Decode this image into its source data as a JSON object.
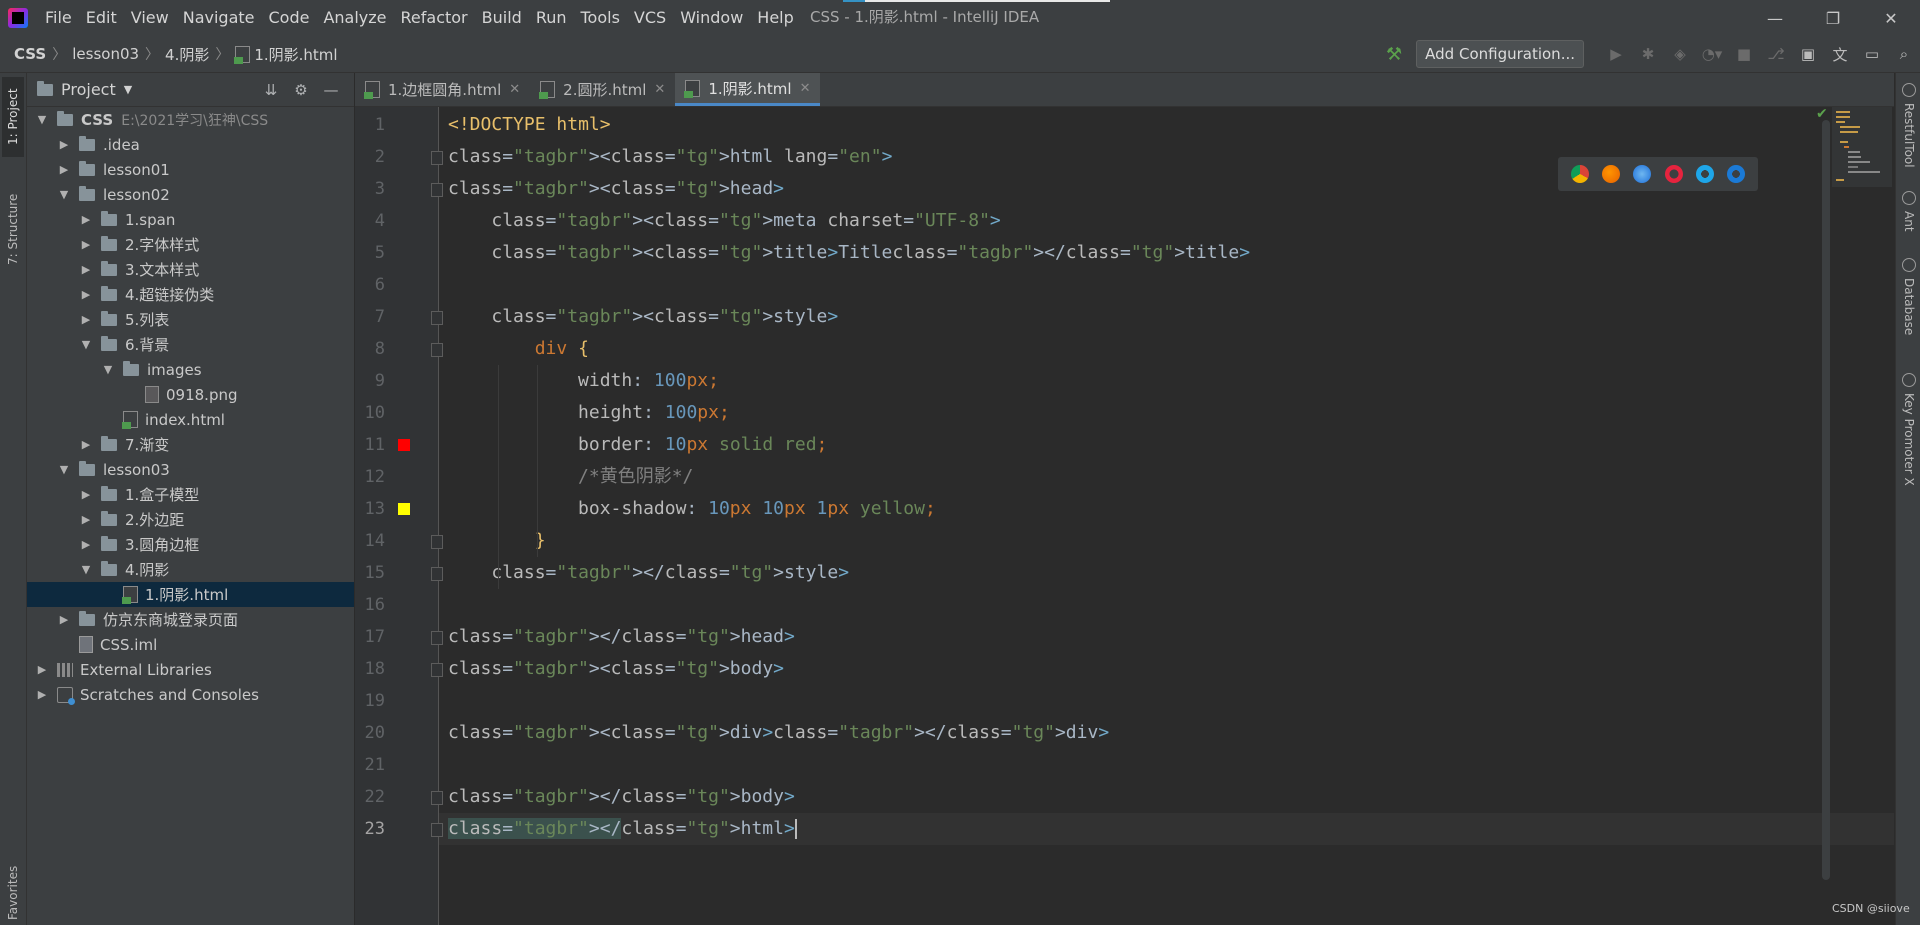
{
  "window": {
    "title": "CSS - 1.阴影.html - IntelliJ IDEA",
    "controls": {
      "minimize": "—",
      "restore": "❐",
      "close": "✕"
    }
  },
  "menu": [
    "File",
    "Edit",
    "View",
    "Navigate",
    "Code",
    "Analyze",
    "Refactor",
    "Build",
    "Run",
    "Tools",
    "VCS",
    "Window",
    "Help"
  ],
  "breadcrumb": [
    "CSS",
    "lesson03",
    "4.阴影",
    "1.阴影.html"
  ],
  "toolbar": {
    "add_config": "Add Configuration..."
  },
  "left_stripe": {
    "project": "1: Project",
    "structure": "7: Structure",
    "favorites": "Favorites"
  },
  "project_panel": {
    "title": "Project",
    "tree": [
      {
        "label": "CSS",
        "path": "E:\\2021学习\\狂神\\CSS",
        "depth": 0,
        "arrow": "▼",
        "type": "folder",
        "bold": true
      },
      {
        "label": ".idea",
        "depth": 1,
        "arrow": "▶",
        "type": "folder"
      },
      {
        "label": "lesson01",
        "depth": 1,
        "arrow": "▶",
        "type": "folder"
      },
      {
        "label": "lesson02",
        "depth": 1,
        "arrow": "▼",
        "type": "folder"
      },
      {
        "label": "1.span",
        "depth": 2,
        "arrow": "▶",
        "type": "folder"
      },
      {
        "label": "2.字体样式",
        "depth": 2,
        "arrow": "▶",
        "type": "folder"
      },
      {
        "label": "3.文本样式",
        "depth": 2,
        "arrow": "▶",
        "type": "folder"
      },
      {
        "label": "4.超链接伪类",
        "depth": 2,
        "arrow": "▶",
        "type": "folder"
      },
      {
        "label": "5.列表",
        "depth": 2,
        "arrow": "▶",
        "type": "folder"
      },
      {
        "label": "6.背景",
        "depth": 2,
        "arrow": "▼",
        "type": "folder"
      },
      {
        "label": "images",
        "depth": 3,
        "arrow": "▼",
        "type": "folder"
      },
      {
        "label": "0918.png",
        "depth": 4,
        "arrow": "",
        "type": "png"
      },
      {
        "label": "index.html",
        "depth": 3,
        "arrow": "",
        "type": "html"
      },
      {
        "label": "7.渐变",
        "depth": 2,
        "arrow": "▶",
        "type": "folder"
      },
      {
        "label": "lesson03",
        "depth": 1,
        "arrow": "▼",
        "type": "folder"
      },
      {
        "label": "1.盒子模型",
        "depth": 2,
        "arrow": "▶",
        "type": "folder"
      },
      {
        "label": "2.外边距",
        "depth": 2,
        "arrow": "▶",
        "type": "folder"
      },
      {
        "label": "3.圆角边框",
        "depth": 2,
        "arrow": "▶",
        "type": "folder"
      },
      {
        "label": "4.阴影",
        "depth": 2,
        "arrow": "▼",
        "type": "folder"
      },
      {
        "label": "1.阴影.html",
        "depth": 3,
        "arrow": "",
        "type": "html",
        "selected": true
      },
      {
        "label": "仿京东商城登录页面",
        "depth": 1,
        "arrow": "▶",
        "type": "folder"
      },
      {
        "label": "CSS.iml",
        "depth": 1,
        "arrow": "",
        "type": "iml"
      },
      {
        "label": "External Libraries",
        "depth": 0,
        "arrow": "▶",
        "type": "lib"
      },
      {
        "label": "Scratches and Consoles",
        "depth": 0,
        "arrow": "▶",
        "type": "scratch"
      }
    ]
  },
  "editor_tabs": [
    {
      "label": "1.边框圆角.html",
      "active": false
    },
    {
      "label": "2.圆形.html",
      "active": false
    },
    {
      "label": "1.阴影.html",
      "active": true
    }
  ],
  "code_lines": [
    "<!DOCTYPE html>",
    "<html lang=\"en\">",
    "<head>",
    "    <meta charset=\"UTF-8\">",
    "    <title>Title</title>",
    "",
    "    <style>",
    "        div {",
    "            width: 100px;",
    "            height: 100px;",
    "            border: 10px solid red;",
    "            /*黄色阴影*/",
    "            box-shadow: 10px 10px 1px yellow;",
    "        }",
    "    </style>",
    "",
    "</head>",
    "<body>",
    "",
    "<div></div>",
    "",
    "</body>",
    "</html>"
  ],
  "gutter_swatches": {
    "11": "#ff0000",
    "13": "#ffff00"
  },
  "current_line": 23,
  "browser_icons": [
    "chrome-icon",
    "firefox-icon",
    "safari-icon",
    "opera-icon",
    "ie-icon",
    "edge-icon"
  ],
  "right_stripe": [
    "RestfulTool",
    "Ant",
    "Database",
    "Key Promoter X"
  ],
  "watermark": "CSDN @siiove"
}
